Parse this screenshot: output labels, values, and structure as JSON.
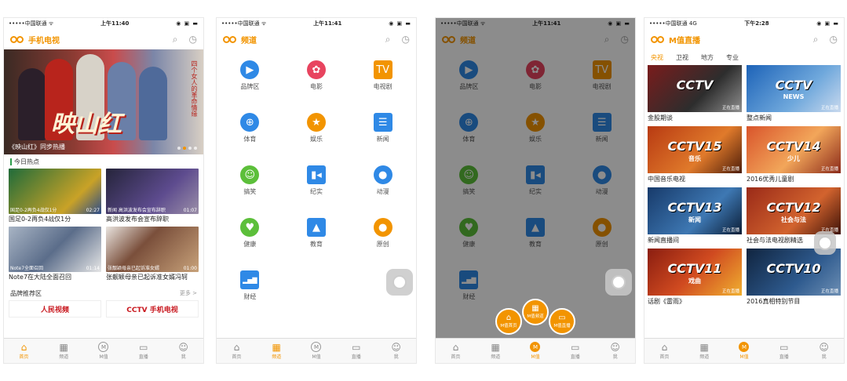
{
  "colors": {
    "accent": "#f29400",
    "bg": "#ffffff",
    "divider": "#dddddd"
  },
  "tabbar": [
    {
      "label": "首页",
      "icon": "home-icon",
      "glyph": "⌂"
    },
    {
      "label": "频道",
      "icon": "grid-icon",
      "glyph": "▦"
    },
    {
      "label": "M值",
      "icon": "m-circle-icon",
      "glyph": "M"
    },
    {
      "label": "直播",
      "icon": "video-icon",
      "glyph": "▭"
    },
    {
      "label": "我",
      "icon": "user-icon",
      "glyph": "☺"
    }
  ],
  "screen1": {
    "status": {
      "carrier": "•••••中国联通 ᯤ",
      "time": "上午11:40",
      "right": "◉ ▣ ▬"
    },
    "header_title": "手机电视",
    "banner": {
      "title": "映山红",
      "vertical": "四个女人的革命情缘",
      "caption": "《映山红》同步热播"
    },
    "section_hot": "今日热点",
    "hot_items": [
      {
        "title": "国足0-2再负4战仅1分",
        "left": "国足0-2再负4战仅1分",
        "right": "02:27",
        "bg": "linear-gradient(135deg,#1f6b3a,#c9a227 70%,#2a4a8a)"
      },
      {
        "title": "高洪波发布会宣布辞职",
        "left": "新闻 高洪波发布会宣布辞职",
        "right": "01:07",
        "bg": "linear-gradient(135deg,#25243a,#5d4b8e 60%,#9b8fa8)"
      },
      {
        "title": "Note7在大陆全面召回",
        "left": "Note7全面召回",
        "right": "01:14",
        "bg": "linear-gradient(135deg,#a8b4c4,#5b6d8a 50%,#e6e6e6)"
      },
      {
        "title": "张靓颖母亲已起诉准女婿冯轲",
        "left": "张靓颖母亲已起诉准女婿",
        "right": "01:00",
        "bg": "linear-gradient(135deg,#e9e4df,#7a4f3b 40%,#c8a27a)"
      }
    ],
    "section_brand": "品牌推荐区",
    "more": "更多 >",
    "brands": [
      "人民视频",
      "CCTV 手机电视"
    ]
  },
  "screen2": {
    "status": {
      "carrier": "•••••中国联通 ᯤ",
      "time": "上午11:41",
      "right": "◉ ▣ ▬"
    },
    "header_title": "频道",
    "channels": [
      {
        "label": "品牌区",
        "icon": "play-icon",
        "glyph": "▶",
        "color": "#2f89e6",
        "sq": false
      },
      {
        "label": "电影",
        "icon": "film-reel-icon",
        "glyph": "✿",
        "color": "#e8445f",
        "sq": false
      },
      {
        "label": "电视剧",
        "icon": "tv-icon",
        "glyph": "TV",
        "color": "#f29400",
        "sq": true
      },
      {
        "label": "体育",
        "icon": "basketball-icon",
        "glyph": "⊕",
        "color": "#2f89e6",
        "sq": false
      },
      {
        "label": "娱乐",
        "icon": "star-icon",
        "glyph": "★",
        "color": "#f29400",
        "sq": false
      },
      {
        "label": "新闻",
        "icon": "newspaper-icon",
        "glyph": "☰",
        "color": "#2f89e6",
        "sq": true
      },
      {
        "label": "搞笑",
        "icon": "smile-icon",
        "glyph": "☺",
        "color": "#5cbf3a",
        "sq": false
      },
      {
        "label": "纪实",
        "icon": "camera-icon",
        "glyph": "▮◂",
        "color": "#2f89e6",
        "sq": true
      },
      {
        "label": "动漫",
        "icon": "bear-icon",
        "glyph": "●",
        "color": "#2f89e6",
        "sq": false
      },
      {
        "label": "健康",
        "icon": "heart-pulse-icon",
        "glyph": "♥",
        "color": "#5cbf3a",
        "sq": false
      },
      {
        "label": "教育",
        "icon": "graduation-cap-icon",
        "glyph": "▲",
        "color": "#2f89e6",
        "sq": true
      },
      {
        "label": "原创",
        "icon": "lightbulb-icon",
        "glyph": "●",
        "color": "#f29400",
        "sq": false
      },
      {
        "label": "财经",
        "icon": "bar-chart-icon",
        "glyph": "▂▅▇",
        "color": "#2f89e6",
        "sq": true
      }
    ]
  },
  "screen3": {
    "status": {
      "carrier": "•••••中国联通 ᯤ",
      "time": "上午11:41",
      "right": "◉ ▣ ▬"
    },
    "header_title": "频道",
    "pop": [
      {
        "label": "M值首页",
        "icon": "home-icon",
        "glyph": "⌂"
      },
      {
        "label": "M值频道",
        "icon": "grid-icon",
        "glyph": "▦"
      },
      {
        "label": "M值直播",
        "icon": "video-icon",
        "glyph": "▭"
      }
    ]
  },
  "screen4": {
    "status": {
      "carrier": "•••••中国联通 4G",
      "time": "下午2:28",
      "right": "◉ ▣ ▬"
    },
    "header_title": "M值直播",
    "cats": [
      "央视",
      "卫视",
      "地方",
      "专业"
    ],
    "live_badge": "正在直播",
    "videos": [
      {
        "title": "金股期谈",
        "logo": "CCTV",
        "sub": "",
        "bg": "linear-gradient(135deg,#7a1c1c,#2d2d2d 60%,#8f8f8f)"
      },
      {
        "title": "整点新闻",
        "logo": "CCTV",
        "sub": "NEWS",
        "bg": "linear-gradient(135deg,#1d63b8,#6fa8dc 60%,#c9d9ee)"
      },
      {
        "title": "中国音乐电视",
        "logo": "CCTV15",
        "sub": "音乐",
        "bg": "linear-gradient(135deg,#b83a12,#e07a2b 60%,#4d1d0a)"
      },
      {
        "title": "2016优秀儿童剧",
        "logo": "CCTV14",
        "sub": "少儿",
        "bg": "linear-gradient(135deg,#d9542b,#f2a65a 55%,#8a2a1a)"
      },
      {
        "title": "新闻直播间",
        "logo": "CCTV13",
        "sub": "新闻",
        "bg": "linear-gradient(135deg,#173a6a,#3e78b3 60%,#0b1d36)"
      },
      {
        "title": "社会与法电视剧精选",
        "logo": "CCTV12",
        "sub": "社会与法",
        "bg": "linear-gradient(135deg,#9a2a18,#d2632e 60%,#3d1208)"
      },
      {
        "title": "话剧《雷雨》",
        "logo": "CCTV11",
        "sub": "戏曲",
        "bg": "linear-gradient(135deg,#8a1d10,#d04a20 50%,#f0b030)"
      },
      {
        "title": "2016真相特别节目",
        "logo": "CCTV10",
        "sub": "",
        "bg": "linear-gradient(135deg,#10243f,#2e5a8e 60%,#6d8fb4)"
      }
    ]
  }
}
